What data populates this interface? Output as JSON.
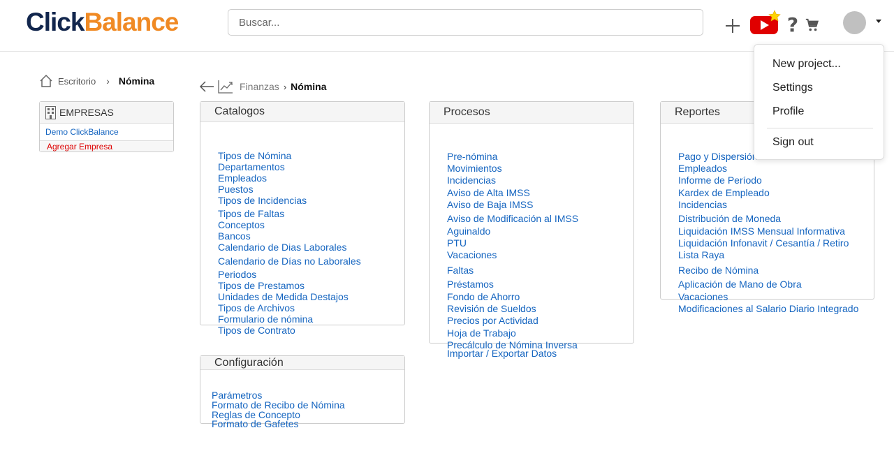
{
  "header": {
    "logo_click": "Click",
    "logo_balance": "Balance",
    "search_placeholder": "Buscar..."
  },
  "user_menu": {
    "items": [
      "New project...",
      "Settings",
      "Profile"
    ],
    "sign_out": "Sign out"
  },
  "breadcrumb_left": {
    "home": "Escritorio",
    "current": "Nómina"
  },
  "empresas": {
    "title": "EMPRESAS",
    "company": "Demo ClickBalance",
    "add": "Agregar Empresa"
  },
  "breadcrumb_main": {
    "parent": "Finanzas",
    "current": "Nómina"
  },
  "panels": {
    "catalogos": {
      "title": "Catalogos",
      "items": [
        "Tipos de Nómina",
        "Departamentos",
        "Empleados",
        "Puestos",
        "Tipos de Incidencias",
        "Tipos de Faltas",
        "Conceptos",
        "Bancos",
        "Calendario de Dias Laborales",
        "Calendario de Días no Laborales",
        "Periodos",
        "Tipos de Prestamos",
        "Unidades de Medida Destajos",
        "Tipos de Archivos",
        "Formulario de nómina",
        "Tipos de Contrato"
      ]
    },
    "procesos": {
      "title": "Procesos",
      "items": [
        "Pre-nómina",
        "Movimientos",
        "Incidencias",
        "Aviso de Alta IMSS",
        "Aviso de Baja IMSS",
        "Aviso de Modificación al IMSS",
        "Aguinaldo",
        "PTU",
        "Vacaciones",
        "Faltas",
        "Préstamos",
        "Fondo de Ahorro",
        "Revisión de Sueldos",
        "Precios por Actividad",
        "Hoja de Trabajo",
        "Precálculo de Nómina Inversa",
        "Importar / Exportar Datos"
      ]
    },
    "reportes": {
      "title": "Reportes",
      "items": [
        "Pago y Dispersión",
        "Empleados",
        "Informe de Período",
        "Kardex de Empleado",
        "Incidencias",
        "Distribución de Moneda",
        "Liquidación IMSS Mensual Informativa",
        "Liquidación Infonavit / Cesantía / Retiro",
        "Lista Raya",
        "Recibo de Nómina",
        "Aplicación de Mano de Obra",
        "Vacaciones",
        "Modificaciones al Salario Diario Integrado"
      ]
    },
    "configuracion": {
      "title": "Configuración",
      "items": [
        "Parámetros",
        "Formato de Recibo de Nómina",
        "Reglas de Concepto",
        "Formato de Gafetes"
      ]
    }
  }
}
